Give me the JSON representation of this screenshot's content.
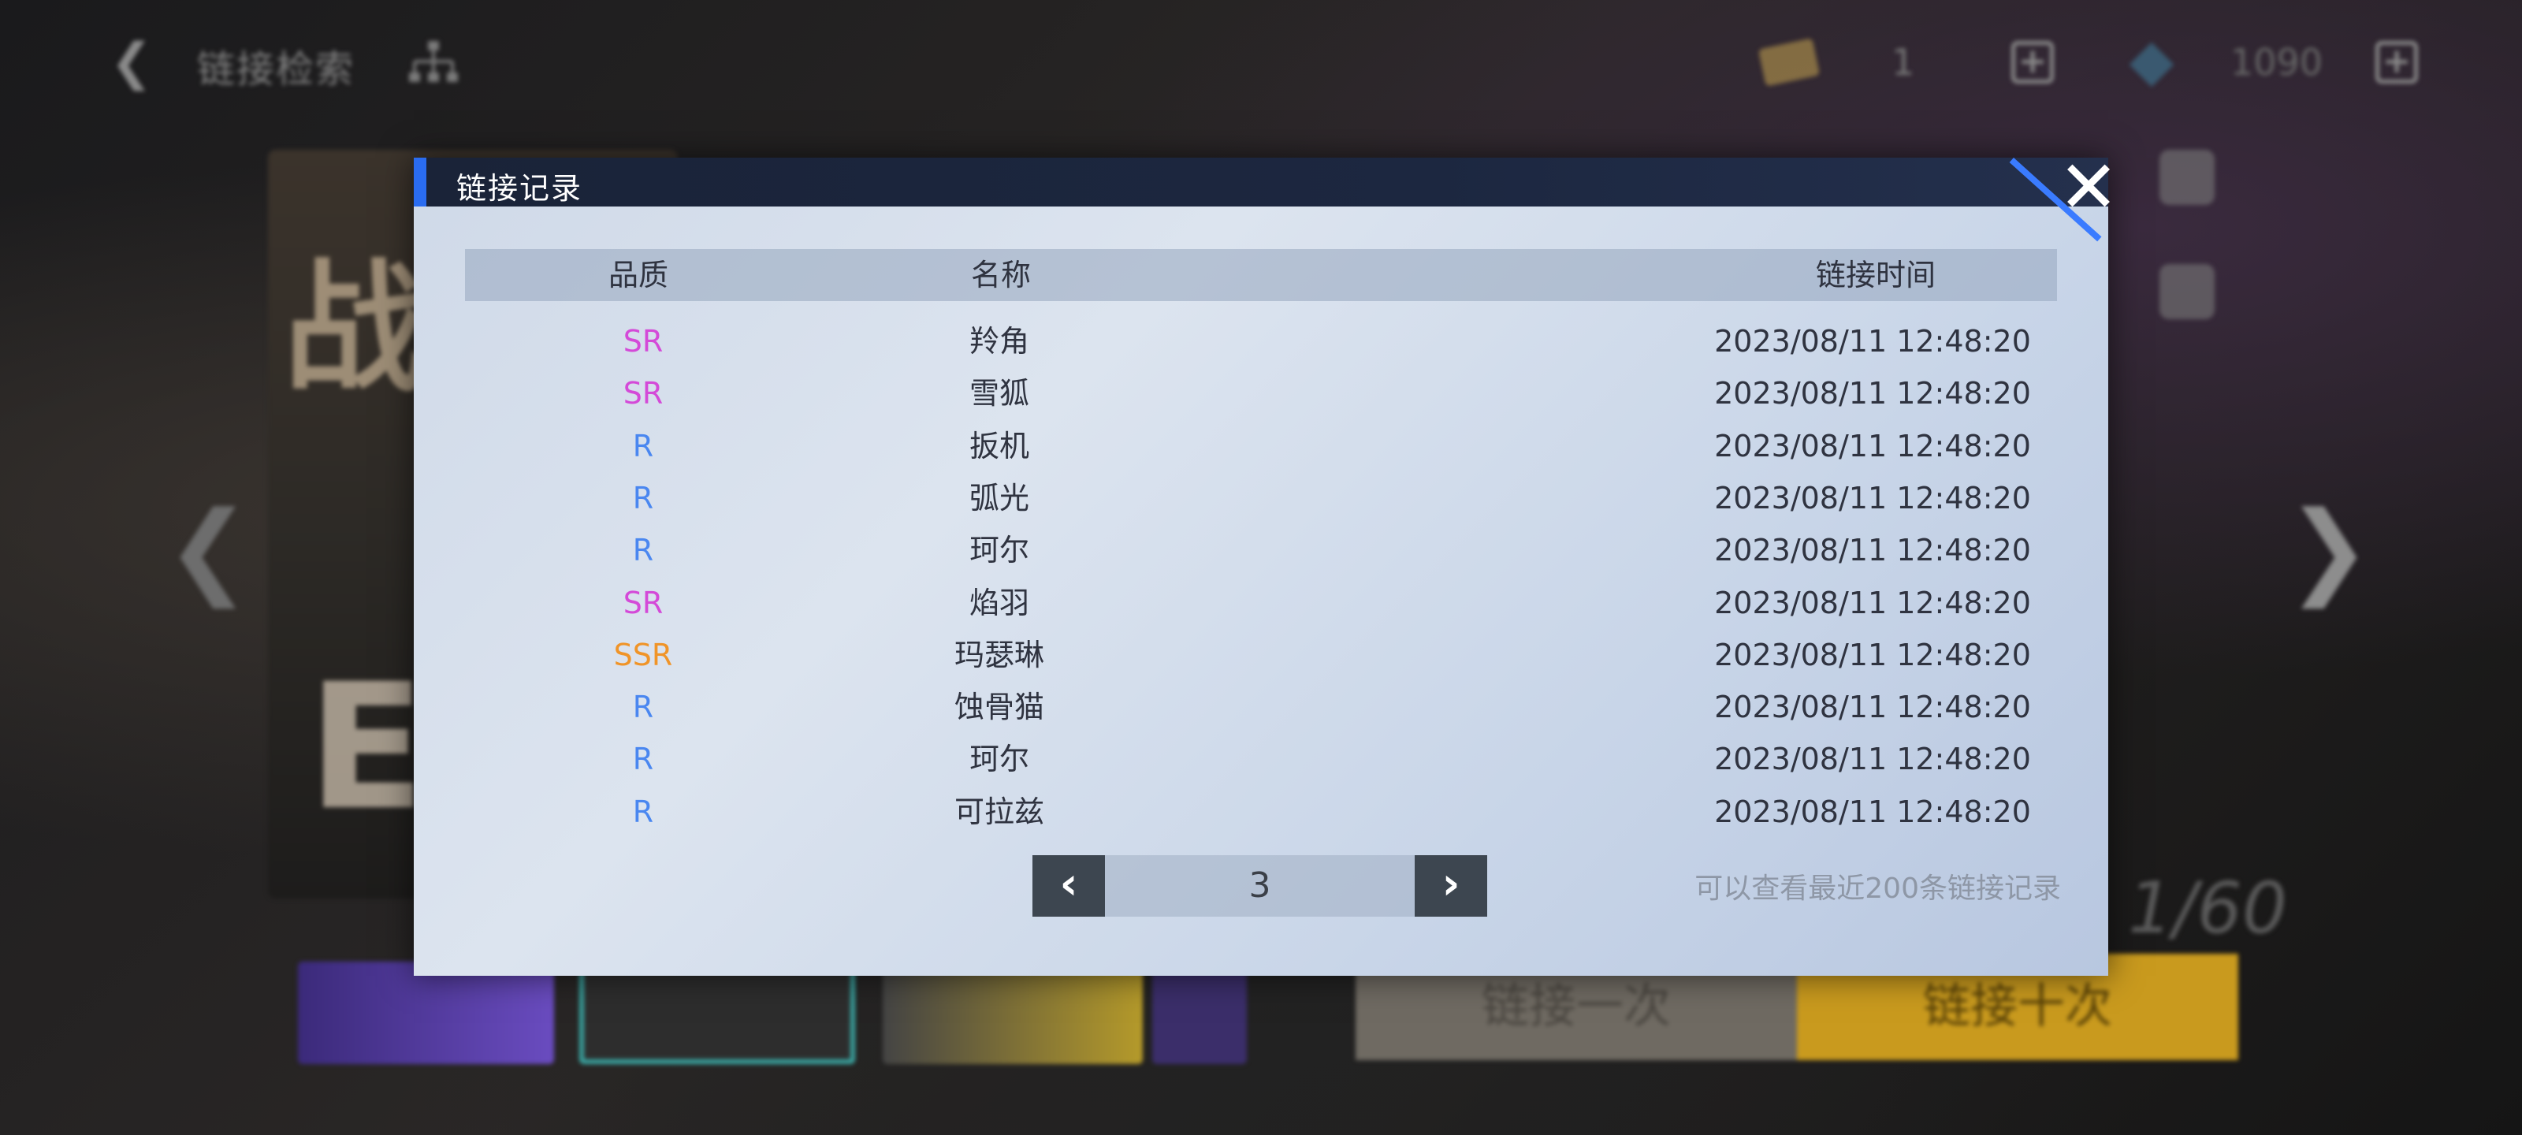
{
  "background": {
    "title": "链接检索",
    "ticket_count": "1",
    "gem_count": "1090",
    "banner_char": "战",
    "banner_letter": "E",
    "progress": "1/60",
    "pull_once_label": "链接一次",
    "pull_ten_label": "链接十次"
  },
  "dialog": {
    "title": "链接记录",
    "close_symbol": "✕",
    "columns": {
      "quality": "品质",
      "name": "名称",
      "time": "链接时间"
    },
    "rows": [
      {
        "quality": "SR",
        "name": "羚角",
        "time": "2023/08/11 12:48:20"
      },
      {
        "quality": "SR",
        "name": "雪狐",
        "time": "2023/08/11 12:48:20"
      },
      {
        "quality": "R",
        "name": "扳机",
        "time": "2023/08/11 12:48:20"
      },
      {
        "quality": "R",
        "name": "弧光",
        "time": "2023/08/11 12:48:20"
      },
      {
        "quality": "R",
        "name": "珂尔",
        "time": "2023/08/11 12:48:20"
      },
      {
        "quality": "SR",
        "name": "焰羽",
        "time": "2023/08/11 12:48:20"
      },
      {
        "quality": "SSR",
        "name": "玛瑟琳",
        "time": "2023/08/11 12:48:20"
      },
      {
        "quality": "R",
        "name": "蚀骨猫",
        "time": "2023/08/11 12:48:20"
      },
      {
        "quality": "R",
        "name": "珂尔",
        "time": "2023/08/11 12:48:20"
      },
      {
        "quality": "R",
        "name": "可拉兹",
        "time": "2023/08/11 12:48:20"
      }
    ],
    "pager": {
      "prev_symbol": "‹",
      "page": "3",
      "next_symbol": "›"
    },
    "footer_note": "可以查看最近200条链接记录"
  },
  "colors": {
    "SR": "#d44ad8",
    "R": "#4a87f0",
    "SSR": "#f09428",
    "header_accent": "#2a6cf0"
  }
}
